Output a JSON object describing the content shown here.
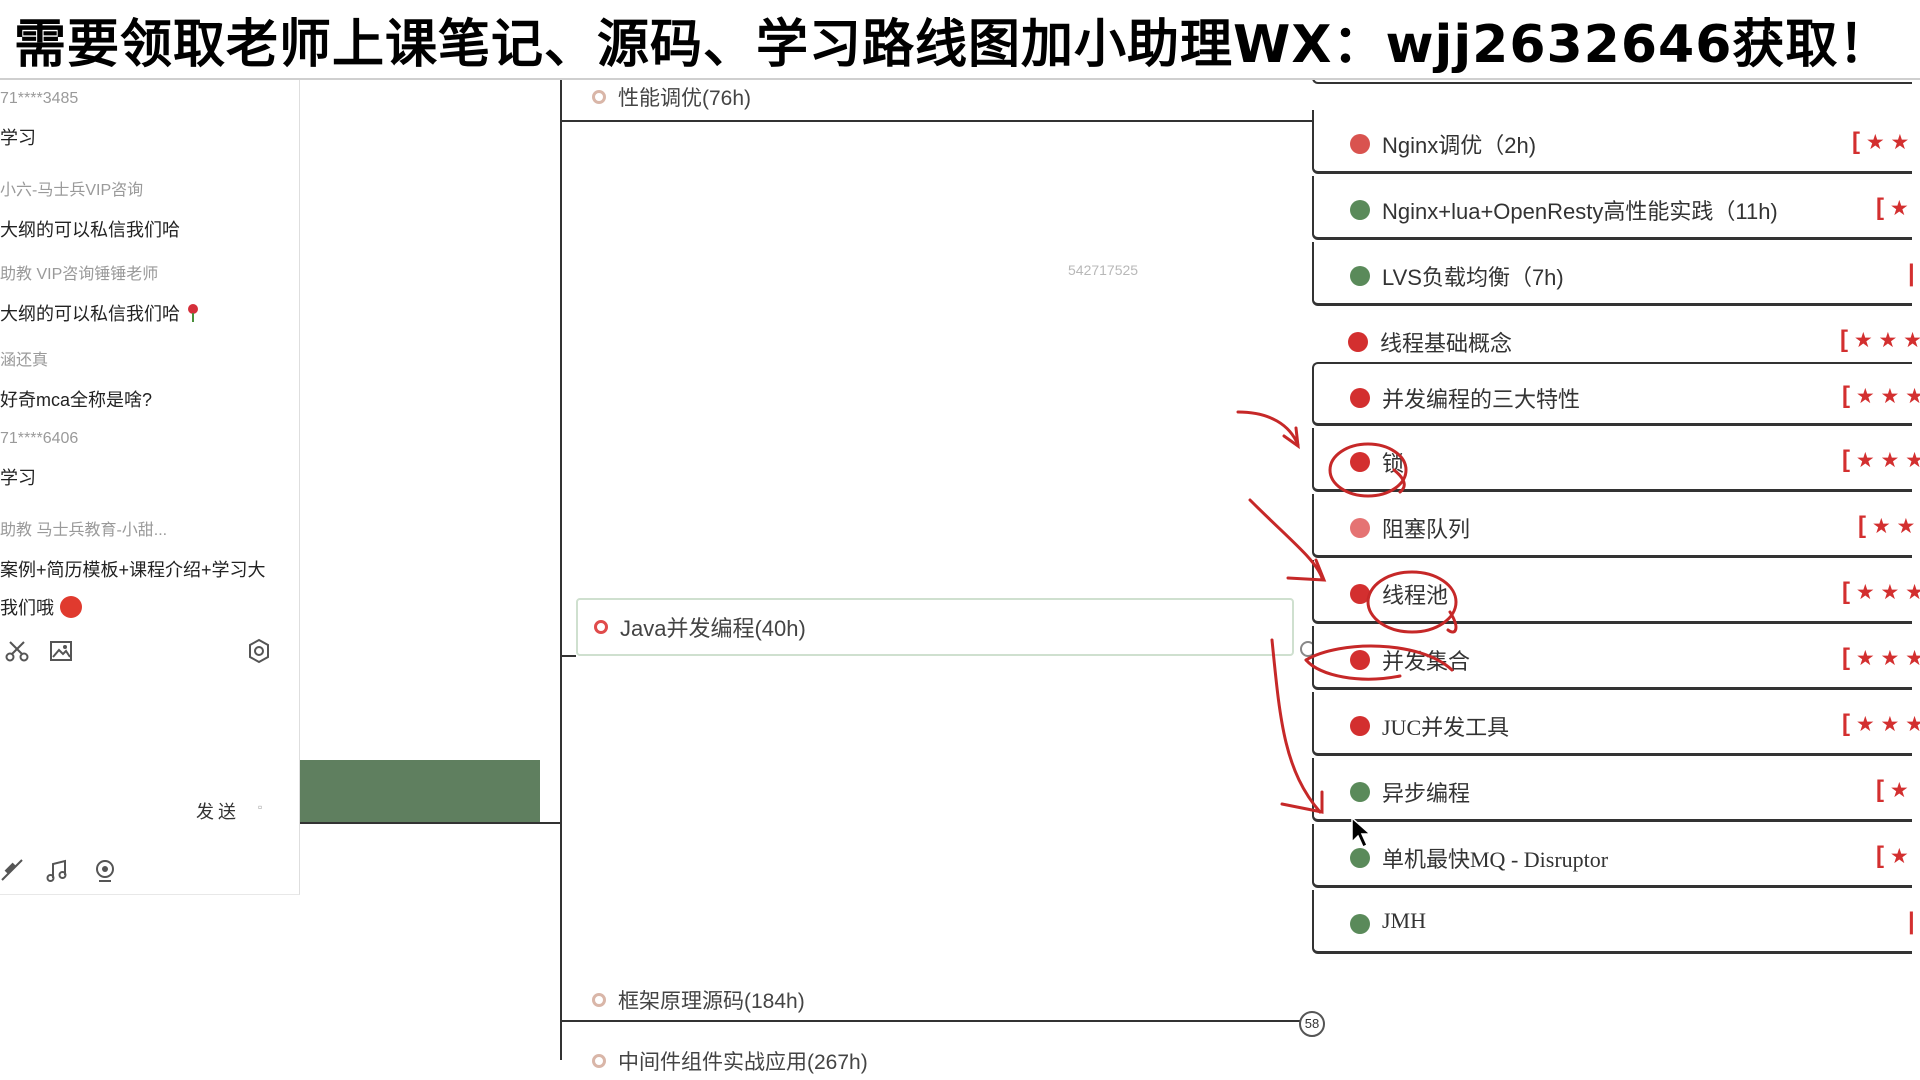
{
  "banner": {
    "text": "需要领取老师上课笔记、源码、学习路线图加小助理WX：wjj2632646获取！"
  },
  "chat": {
    "messages": [
      {
        "user": "71****3485",
        "text": "学习"
      },
      {
        "user": "小六-马士兵VIP咨询",
        "text": "大纲的可以私信我们哈"
      },
      {
        "user": "助教 VIP咨询锤锤老师",
        "text": "大纲的可以私信我们哈"
      },
      {
        "user": "涵还真",
        "text": "好奇mca全称是啥?"
      },
      {
        "user": "71****6406",
        "text": "学习"
      },
      {
        "user": "助教 马士兵教育-小甜...",
        "text": "案例+简历模板+课程介绍+学习大",
        "text2": "我们哦"
      }
    ],
    "send_label": "发送",
    "send_dropdown": "▫"
  },
  "mindmap": {
    "topics": [
      {
        "label": "性能调优(76h)"
      },
      {
        "label": "Java并发编程(40h)"
      },
      {
        "label": "框架原理源码(184h)"
      },
      {
        "label": "中间件组件实战应用(267h)"
      }
    ],
    "watermark": "542717525",
    "collapse_count": "58",
    "items": [
      {
        "label": "Nginx调优（2h)",
        "stars": "★ ★",
        "dot_color": "#d9534f"
      },
      {
        "label": "Nginx+lua+OpenResty高性能实践（11h)",
        "stars": "★",
        "dot_color": "#5a8a5a"
      },
      {
        "label": "LVS负载均衡（7h)",
        "stars": "",
        "dot_color": "#5a8a5a"
      },
      {
        "label": "线程基础概念",
        "stars": "★ ★ ★",
        "dot_color": "#d32f2f"
      },
      {
        "label": "并发编程的三大特性",
        "stars": "★ ★ ★",
        "dot_color": "#d32f2f"
      },
      {
        "label": "锁",
        "stars": "★ ★ ★",
        "dot_color": "#d32f2f"
      },
      {
        "label": "阻塞队列",
        "stars": "★ ★",
        "dot_color": "#e57373"
      },
      {
        "label": "线程池",
        "stars": "★ ★ ★",
        "dot_color": "#d32f2f"
      },
      {
        "label": "并发集合",
        "stars": "★ ★ ★",
        "dot_color": "#d32f2f"
      },
      {
        "label": "JUC并发工具",
        "stars": "★ ★ ★",
        "dot_color": "#d32f2f"
      },
      {
        "label": "异步编程",
        "stars": "★",
        "dot_color": "#5a8a5a"
      },
      {
        "label": "单机最快MQ - Disruptor",
        "stars": "★",
        "dot_color": "#5a8a5a"
      },
      {
        "label": "JMH",
        "stars": "",
        "dot_color": "#5a8a5a"
      }
    ]
  },
  "colors": {
    "annotation_red": "#c62828",
    "panel_green": "#5f7f5f"
  }
}
